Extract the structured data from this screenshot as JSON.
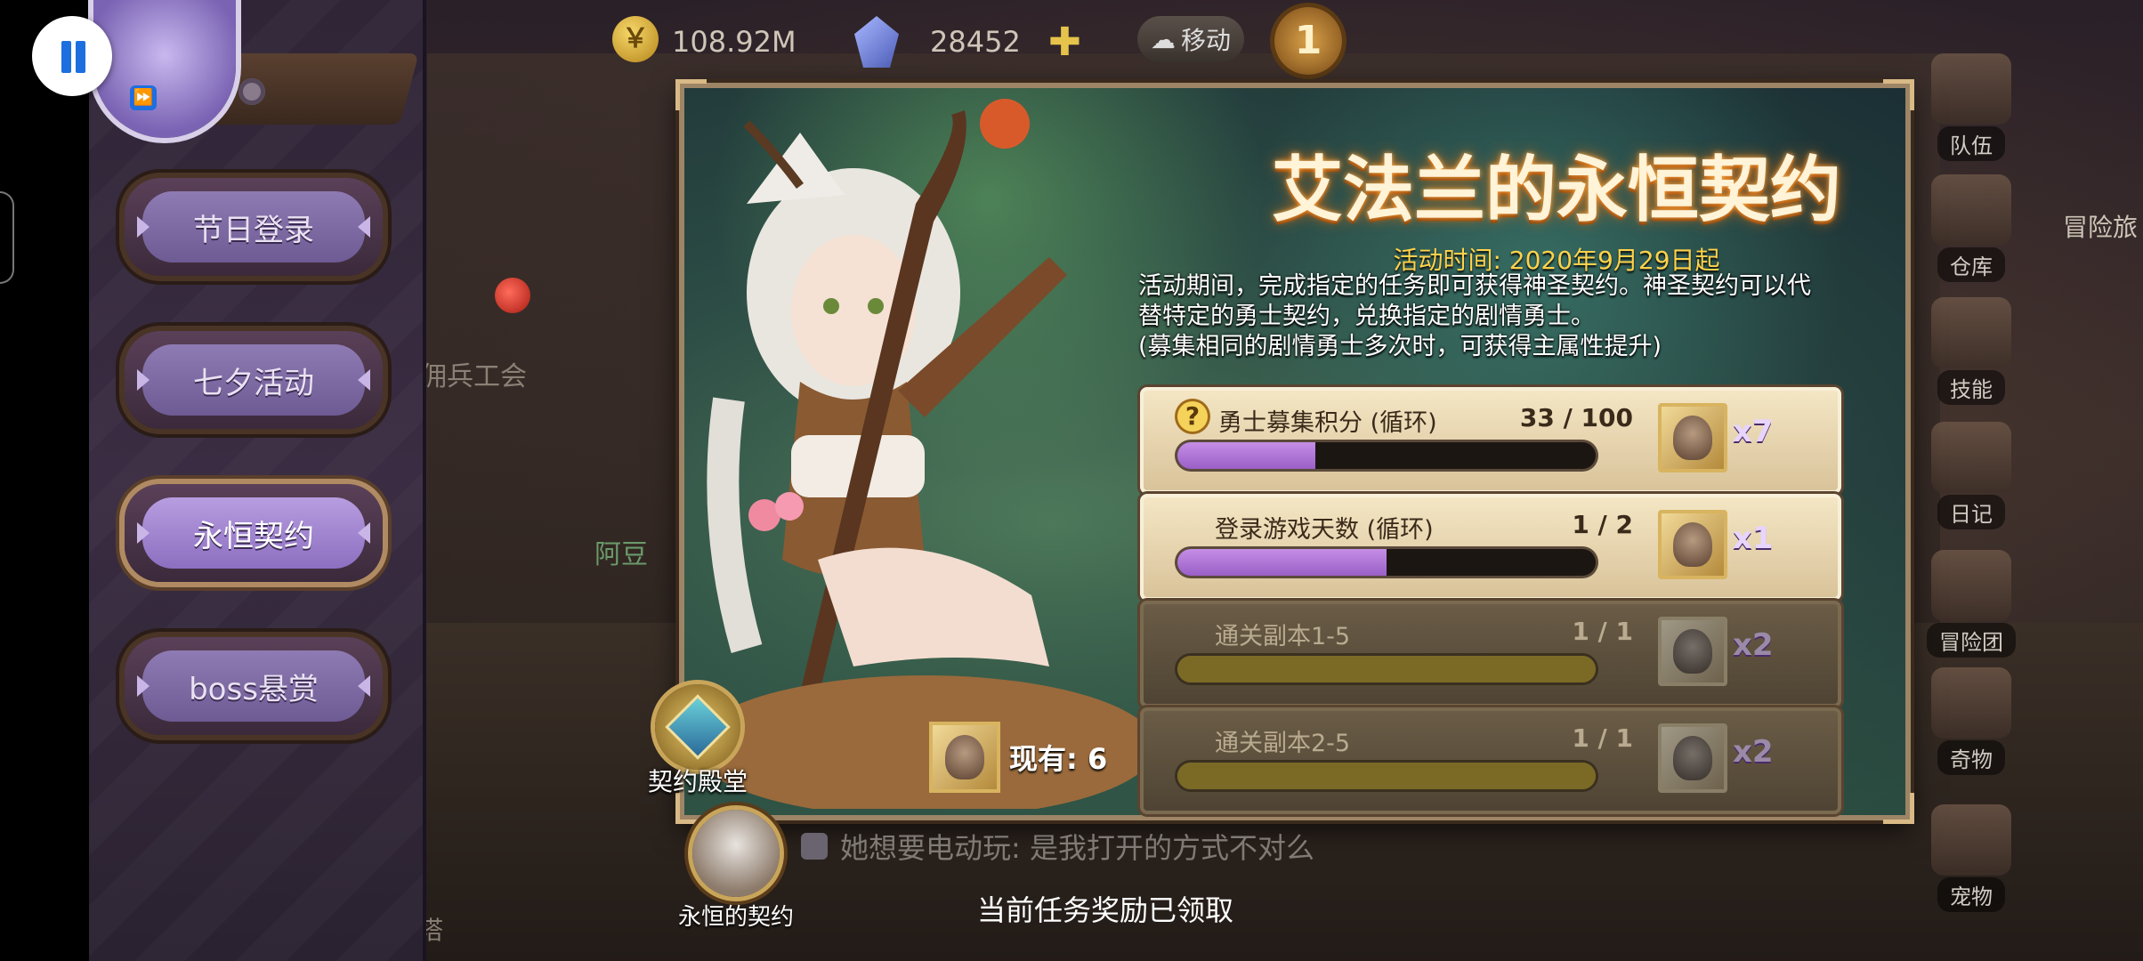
{
  "topbar": {
    "gold": "108.92M",
    "gems": "28452",
    "move_label": "移动",
    "rank": "1"
  },
  "side_menu": {
    "items": [
      {
        "label": "节日登录",
        "active": false
      },
      {
        "label": "七夕活动",
        "active": false
      },
      {
        "label": "永恒契约",
        "active": true
      },
      {
        "label": "boss悬赏",
        "active": false
      }
    ]
  },
  "right_menu": [
    {
      "label": "队伍",
      "icon": "book-icon"
    },
    {
      "label": "仓库",
      "icon": "backpack-icon"
    },
    {
      "label": "技能",
      "icon": "skill-book-icon"
    },
    {
      "label": "日记",
      "icon": "diary-icon"
    },
    {
      "label": "冒险团",
      "icon": "guild-icon"
    },
    {
      "label": "奇物",
      "icon": "relic-icon"
    },
    {
      "label": "宠物",
      "icon": "pet-icon"
    }
  ],
  "right_edge_label": "冒险旅",
  "background": {
    "guild_label": "佣兵工会",
    "npc_name": "阿豆",
    "tower_label": "塔"
  },
  "panel": {
    "title": "艾法兰的永恒契约",
    "time": "活动时间: 2020年9月29日起",
    "description": "活动期间，完成指定的任务即可获得神圣契约。神圣契约可以代替特定的勇士契约，兑换指定的剧情勇士。\n(募集相同的剧情勇士多次时，可获得主属性提升)",
    "hall_label": "契约殿堂",
    "owned_label": "现有: 6",
    "tasks": [
      {
        "name": "勇士募集积分 (循环)",
        "progress": "33 / 100",
        "ratio": 0.33,
        "reward_mult": "x7",
        "done": false,
        "has_help": true
      },
      {
        "name": "登录游戏天数 (循环)",
        "progress": "1 / 2",
        "ratio": 0.5,
        "reward_mult": "x1",
        "done": false,
        "has_help": false
      },
      {
        "name": "通关副本1-5",
        "progress": "1 / 1",
        "ratio": 1.0,
        "reward_mult": "x2",
        "done": true,
        "has_help": false
      },
      {
        "name": "通关副本2-5",
        "progress": "1 / 1",
        "ratio": 1.0,
        "reward_mult": "x2",
        "done": true,
        "has_help": false
      }
    ]
  },
  "chat": {
    "message": "她想要电动玩: 是我打开的方式不对么"
  },
  "contract_tab_label": "永恒的契约",
  "status_text": "当前任务奖励已领取",
  "colors": {
    "title_glow": "#d66a10",
    "time_text": "#ffd24a",
    "progress_fill": "#9b5fc6",
    "menu_active": "#b79de0"
  }
}
